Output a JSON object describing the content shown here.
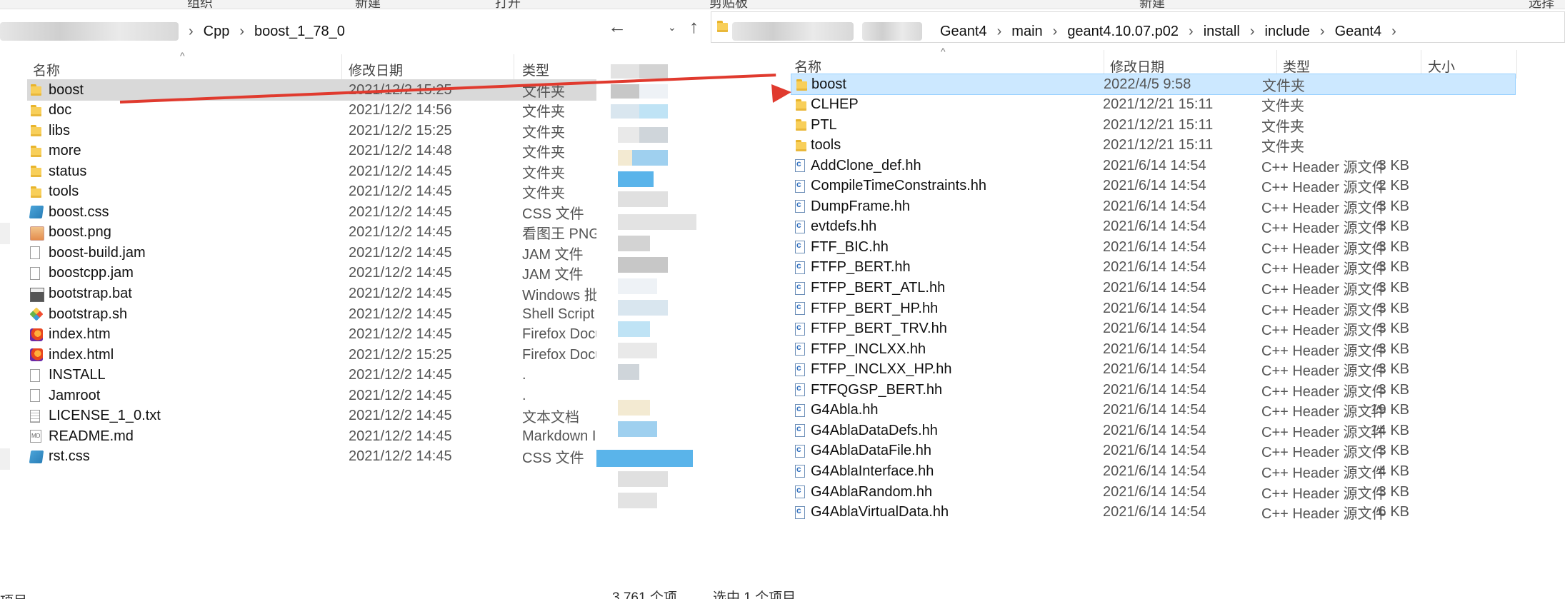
{
  "left": {
    "ribbon": {
      "items": [
        "组织",
        "新建",
        "打开"
      ]
    },
    "breadcrumb": [
      "Cpp",
      "boost_1_78_0"
    ],
    "columns": {
      "name": "名称",
      "date": "修改日期",
      "type": "类型"
    },
    "rows": [
      {
        "icon": "folder",
        "name": "boost",
        "date": "2021/12/2 15:25",
        "type": "文件夹"
      },
      {
        "icon": "folder",
        "name": "doc",
        "date": "2021/12/2 14:56",
        "type": "文件夹"
      },
      {
        "icon": "folder",
        "name": "libs",
        "date": "2021/12/2 15:25",
        "type": "文件夹"
      },
      {
        "icon": "folder",
        "name": "more",
        "date": "2021/12/2 14:48",
        "type": "文件夹"
      },
      {
        "icon": "folder",
        "name": "status",
        "date": "2021/12/2 14:45",
        "type": "文件夹"
      },
      {
        "icon": "folder",
        "name": "tools",
        "date": "2021/12/2 14:45",
        "type": "文件夹"
      },
      {
        "icon": "css",
        "name": "boost.css",
        "date": "2021/12/2 14:45",
        "type": "CSS 文件"
      },
      {
        "icon": "png",
        "name": "boost.png",
        "date": "2021/12/2 14:45",
        "type": "看图王 PNG"
      },
      {
        "icon": "doc",
        "name": "boost-build.jam",
        "date": "2021/12/2 14:45",
        "type": "JAM 文件"
      },
      {
        "icon": "doc",
        "name": "boostcpp.jam",
        "date": "2021/12/2 14:45",
        "type": "JAM 文件"
      },
      {
        "icon": "bat",
        "name": "bootstrap.bat",
        "date": "2021/12/2 14:45",
        "type": "Windows 批"
      },
      {
        "icon": "sh",
        "name": "bootstrap.sh",
        "date": "2021/12/2 14:45",
        "type": "Shell Script"
      },
      {
        "icon": "fx",
        "name": "index.htm",
        "date": "2021/12/2 14:45",
        "type": "Firefox Docu"
      },
      {
        "icon": "fx",
        "name": "index.html",
        "date": "2021/12/2 15:25",
        "type": "Firefox Docu"
      },
      {
        "icon": "doc",
        "name": "INSTALL",
        "date": "2021/12/2 14:45",
        "type": "."
      },
      {
        "icon": "doc",
        "name": "Jamroot",
        "date": "2021/12/2 14:45",
        "type": "."
      },
      {
        "icon": "txt",
        "name": "LICENSE_1_0.txt",
        "date": "2021/12/2 14:45",
        "type": "文本文档"
      },
      {
        "icon": "md",
        "name": "README.md",
        "date": "2021/12/2 14:45",
        "type": "Markdown I"
      },
      {
        "icon": "css",
        "name": "rst.css",
        "date": "2021/12/2 14:45",
        "type": "CSS 文件"
      }
    ],
    "status": "项目"
  },
  "right": {
    "ribbon": {
      "items": [
        "剪贴板",
        "新建",
        "选择"
      ]
    },
    "breadcrumb": [
      "Geant4",
      "main",
      "geant4.10.07.p02",
      "install",
      "include",
      "Geant4"
    ],
    "columns": {
      "name": "名称",
      "date": "修改日期",
      "type": "类型",
      "size": "大小"
    },
    "rows": [
      {
        "icon": "folder",
        "name": "boost",
        "date": "2022/4/5 9:58",
        "type": "文件夹",
        "size": ""
      },
      {
        "icon": "folder",
        "name": "CLHEP",
        "date": "2021/12/21 15:11",
        "type": "文件夹",
        "size": ""
      },
      {
        "icon": "folder",
        "name": "PTL",
        "date": "2021/12/21 15:11",
        "type": "文件夹",
        "size": ""
      },
      {
        "icon": "folder",
        "name": "tools",
        "date": "2021/12/21 15:11",
        "type": "文件夹",
        "size": ""
      },
      {
        "icon": "h",
        "name": "AddClone_def.hh",
        "date": "2021/6/14 14:54",
        "type": "C++ Header 源文件",
        "size": "3 KB"
      },
      {
        "icon": "h",
        "name": "CompileTimeConstraints.hh",
        "date": "2021/6/14 14:54",
        "type": "C++ Header 源文件",
        "size": "2 KB"
      },
      {
        "icon": "h",
        "name": "DumpFrame.hh",
        "date": "2021/6/14 14:54",
        "type": "C++ Header 源文件",
        "size": "3 KB"
      },
      {
        "icon": "h",
        "name": "evtdefs.hh",
        "date": "2021/6/14 14:54",
        "type": "C++ Header 源文件",
        "size": "3 KB"
      },
      {
        "icon": "h",
        "name": "FTF_BIC.hh",
        "date": "2021/6/14 14:54",
        "type": "C++ Header 源文件",
        "size": "3 KB"
      },
      {
        "icon": "h",
        "name": "FTFP_BERT.hh",
        "date": "2021/6/14 14:54",
        "type": "C++ Header 源文件",
        "size": "3 KB"
      },
      {
        "icon": "h",
        "name": "FTFP_BERT_ATL.hh",
        "date": "2021/6/14 14:54",
        "type": "C++ Header 源文件",
        "size": "3 KB"
      },
      {
        "icon": "h",
        "name": "FTFP_BERT_HP.hh",
        "date": "2021/6/14 14:54",
        "type": "C++ Header 源文件",
        "size": "3 KB"
      },
      {
        "icon": "h",
        "name": "FTFP_BERT_TRV.hh",
        "date": "2021/6/14 14:54",
        "type": "C++ Header 源文件",
        "size": "3 KB"
      },
      {
        "icon": "h",
        "name": "FTFP_INCLXX.hh",
        "date": "2021/6/14 14:54",
        "type": "C++ Header 源文件",
        "size": "3 KB"
      },
      {
        "icon": "h",
        "name": "FTFP_INCLXX_HP.hh",
        "date": "2021/6/14 14:54",
        "type": "C++ Header 源文件",
        "size": "3 KB"
      },
      {
        "icon": "h",
        "name": "FTFQGSP_BERT.hh",
        "date": "2021/6/14 14:54",
        "type": "C++ Header 源文件",
        "size": "3 KB"
      },
      {
        "icon": "h",
        "name": "G4Abla.hh",
        "date": "2021/6/14 14:54",
        "type": "C++ Header 源文件",
        "size": "19 KB"
      },
      {
        "icon": "h",
        "name": "G4AblaDataDefs.hh",
        "date": "2021/6/14 14:54",
        "type": "C++ Header 源文件",
        "size": "14 KB"
      },
      {
        "icon": "h",
        "name": "G4AblaDataFile.hh",
        "date": "2021/6/14 14:54",
        "type": "C++ Header 源文件",
        "size": "3 KB"
      },
      {
        "icon": "h",
        "name": "G4AblaInterface.hh",
        "date": "2021/6/14 14:54",
        "type": "C++ Header 源文件",
        "size": "4 KB"
      },
      {
        "icon": "h",
        "name": "G4AblaRandom.hh",
        "date": "2021/6/14 14:54",
        "type": "C++ Header 源文件",
        "size": "3 KB"
      },
      {
        "icon": "h",
        "name": "G4AblaVirtualData.hh",
        "date": "2021/6/14 14:54",
        "type": "C++ Header 源文件",
        "size": "6 KB"
      }
    ],
    "status": {
      "count": "3,761 个项",
      "selected": "选中 1 个项目"
    }
  },
  "colors": {
    "selection": "#cce8ff",
    "selection_border": "#99d1ff",
    "arrow": "#e03a2e",
    "folder": "#f8cf5a"
  }
}
